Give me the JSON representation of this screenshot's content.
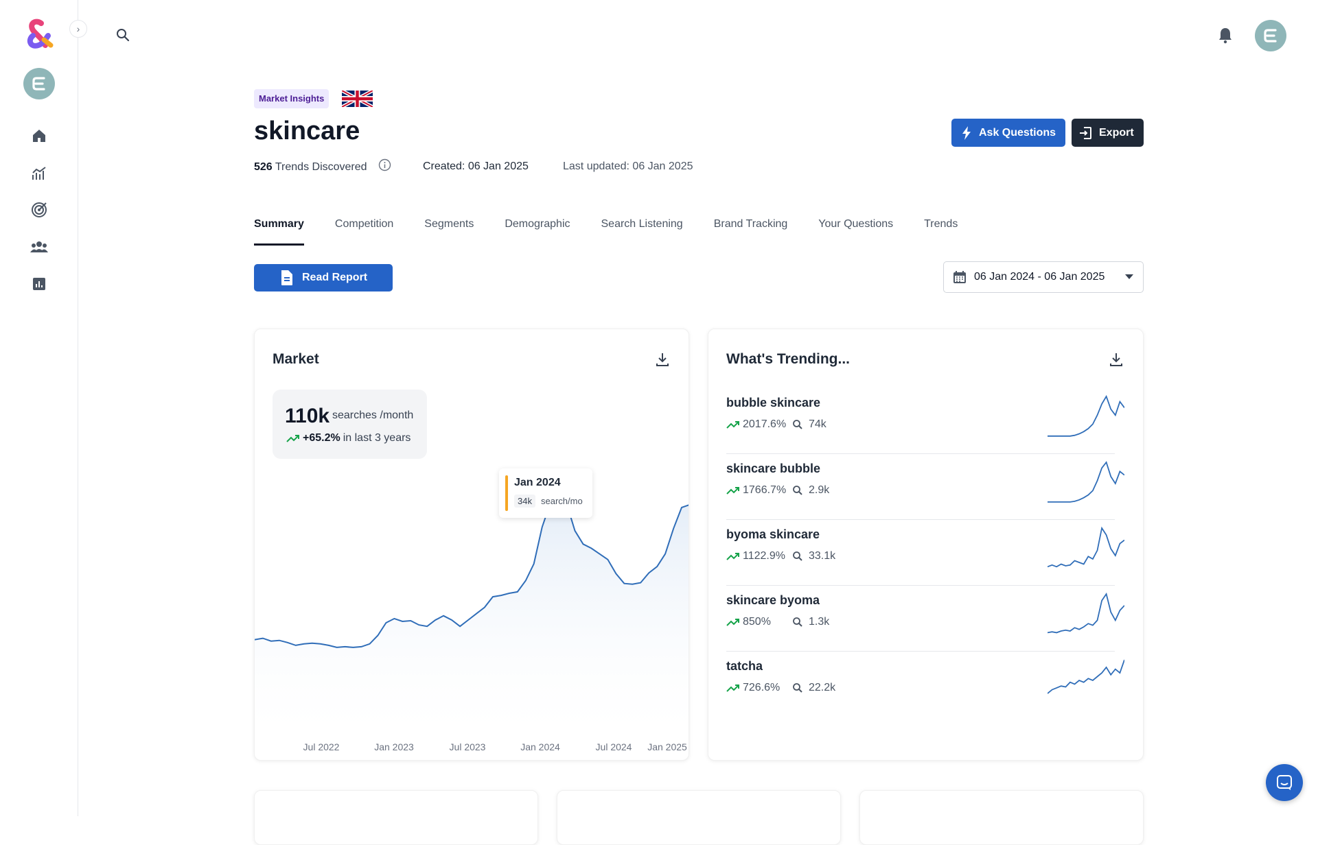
{
  "header": {
    "badge": "Market Insights",
    "title": "skincare",
    "trends_count": "526",
    "trends_label": "Trends Discovered",
    "created": "Created: 06 Jan 2025",
    "updated": "Last updated: 06 Jan 2025",
    "ask_label": "Ask Questions",
    "export_label": "Export"
  },
  "tabs": [
    "Summary",
    "Competition",
    "Segments",
    "Demographic",
    "Search Listening",
    "Brand Tracking",
    "Your Questions",
    "Trends"
  ],
  "controls": {
    "read_report_label": "Read Report",
    "date_range": "06 Jan 2024 - 06 Jan 2025"
  },
  "market": {
    "title": "Market",
    "big_value": "110k",
    "unit": "searches /month",
    "delta": "+65.2%",
    "delta_suffix": "in last 3 years",
    "tooltip_date": "Jan 2024",
    "tooltip_value": "34k",
    "tooltip_unit": "search/mo"
  },
  "chart_data": {
    "type": "area",
    "x_tick_labels": [
      "Jul 2022",
      "Jan 2023",
      "Jul 2023",
      "Jan 2024",
      "Jul 2024",
      "Jan 2025"
    ],
    "series": [
      {
        "values": [
          13.4,
          13.6,
          13.2,
          13.3,
          13.0,
          12.6,
          12.8,
          12.9,
          12.8,
          12.6,
          12.3,
          12.4,
          12.3,
          12.4,
          12.8,
          14.0,
          15.8,
          16.4,
          16.0,
          16.1,
          15.5,
          15.3,
          16.2,
          16.8,
          16.2,
          15.3,
          16.2,
          17.1,
          18.0,
          19.5,
          19.7,
          20.0,
          20.2,
          21.8,
          24.2,
          29.4,
          32.8,
          34.2,
          32.7,
          28.9,
          27.0,
          26.4,
          25.6,
          24.8,
          22.8,
          21.4,
          21.3,
          21.5,
          22.9,
          23.8,
          25.6,
          29.2,
          32.2,
          32.6
        ]
      }
    ],
    "ylabel": "search/mo",
    "highlight": {
      "x": "Jan 2024",
      "value": "34k"
    }
  },
  "trending": {
    "title": "What's Trending...",
    "items": [
      {
        "name": "bubble skincare",
        "pct": "2017.6%",
        "vol": "74k",
        "spark": [
          2,
          2,
          2,
          2,
          2,
          2,
          3,
          5,
          8,
          12,
          18,
          30,
          45,
          55,
          38,
          30,
          48,
          40
        ]
      },
      {
        "name": "skincare bubble",
        "pct": "1766.7%",
        "vol": "2.9k",
        "spark": [
          2,
          2,
          2,
          2,
          2,
          2,
          3,
          5,
          8,
          12,
          18,
          32,
          50,
          58,
          38,
          28,
          45,
          40
        ]
      },
      {
        "name": "byoma skincare",
        "pct": "1122.9%",
        "vol": "33.1k",
        "spark": [
          3,
          5,
          3,
          6,
          4,
          5,
          10,
          8,
          6,
          15,
          12,
          22,
          48,
          40,
          24,
          16,
          30,
          34
        ]
      },
      {
        "name": "skincare byoma",
        "pct": "850%",
        "vol": "1.3k",
        "spark": [
          3,
          4,
          3,
          5,
          6,
          5,
          9,
          7,
          10,
          14,
          12,
          18,
          42,
          50,
          28,
          18,
          30,
          36
        ]
      },
      {
        "name": "tatcha",
        "pct": "726.6%",
        "vol": "22.2k",
        "spark": [
          8,
          12,
          14,
          16,
          15,
          20,
          18,
          22,
          20,
          24,
          22,
          26,
          30,
          36,
          28,
          34,
          30,
          44
        ]
      }
    ]
  },
  "colors": {
    "primary": "#2563c7",
    "dark": "#1f2937",
    "trend_up": "#16a34a",
    "line": "#2f6db8",
    "tooltip_accent": "#f5a623"
  }
}
